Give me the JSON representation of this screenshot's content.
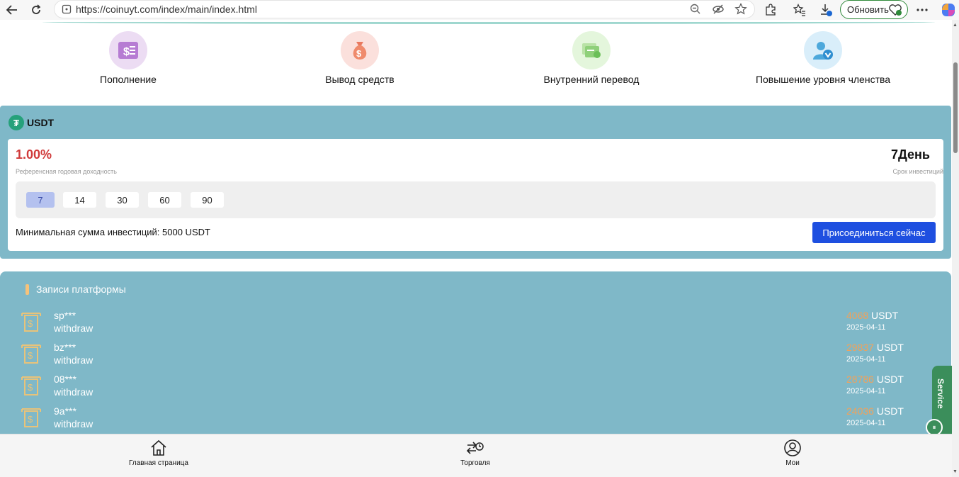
{
  "browser": {
    "url": "https://coinuyt.com/index/main/index.html",
    "update_label": "Обновить"
  },
  "actions": [
    {
      "label": "Пополнение",
      "icon": "deposit-icon",
      "color": "#ecdcf3"
    },
    {
      "label": "Вывод средств",
      "icon": "money-bag-icon",
      "color": "#fbe0dc"
    },
    {
      "label": "Внутренний перевод",
      "icon": "transfer-icon",
      "color": "#e4f6dc"
    },
    {
      "label": "Повышение уровня членства",
      "icon": "member-upgrade-icon",
      "color": "#d9eefa"
    }
  ],
  "product": {
    "coin": "USDT",
    "rate": "1.00%",
    "rate_label": "Референсная годовая доходность",
    "term": "7День",
    "term_label": "Срок инвестиций",
    "periods": [
      "7",
      "14",
      "30",
      "60",
      "90"
    ],
    "selected_period": "7",
    "min_sum": "Минимальная сумма инвестиций:  5000 USDT",
    "join_label": "Присоединиться сейчас"
  },
  "records": {
    "title": "Записи платформы",
    "rows": [
      {
        "user": "sp***",
        "type": "withdraw",
        "amount": "4068",
        "unit": "USDT",
        "date": "2025-04-11"
      },
      {
        "user": "bz***",
        "type": "withdraw",
        "amount": "29837",
        "unit": "USDT",
        "date": "2025-04-11"
      },
      {
        "user": "08***",
        "type": "withdraw",
        "amount": "28786",
        "unit": "USDT",
        "date": "2025-04-11"
      },
      {
        "user": "9a***",
        "type": "withdraw",
        "amount": "24036",
        "unit": "USDT",
        "date": "2025-04-11"
      }
    ]
  },
  "service": {
    "label": "Service"
  },
  "bottom_nav": [
    {
      "label": "Главная страница",
      "icon": "home-icon"
    },
    {
      "label": "Торговля",
      "icon": "trade-icon"
    },
    {
      "label": "Мои",
      "icon": "profile-icon"
    }
  ]
}
